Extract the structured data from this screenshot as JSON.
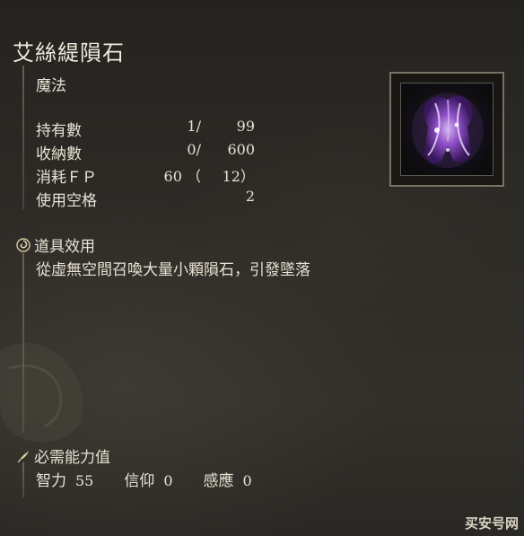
{
  "item": {
    "name": "艾絲緹隕石",
    "category": "魔法"
  },
  "stats": {
    "held": {
      "label": "持有數",
      "current": "1/",
      "max": "99"
    },
    "stored": {
      "label": "收納數",
      "current": "0/",
      "max": "600"
    },
    "fp": {
      "label": "消耗ＦＰ",
      "main": "60 （",
      "extra": "12）"
    },
    "slots": {
      "label": "使用空格",
      "value": "2"
    }
  },
  "effect": {
    "heading": "道具效用",
    "text": "從虛無空間召喚大量小顆隕石，引發墜落"
  },
  "requirements": {
    "heading": "必需能力值",
    "intelligence": {
      "label": "智力",
      "value": "55"
    },
    "faith": {
      "label": "信仰",
      "value": "0"
    },
    "arcane": {
      "label": "感應",
      "value": "0"
    }
  },
  "watermark": "买安号网",
  "icons": {
    "effect": "swirl-icon",
    "requirements": "feather-icon",
    "item": "meteorite-sorcery-icon"
  }
}
